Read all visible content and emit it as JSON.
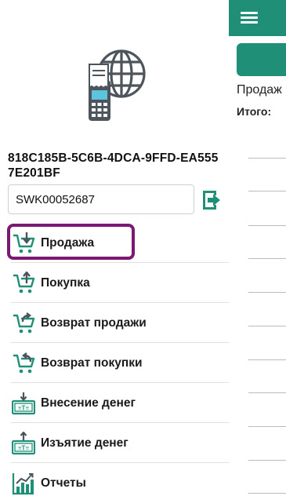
{
  "device": {
    "id": "818C185B-5C6B-4DCA-9FFD-EA5557E201BF",
    "serial_value": "SWK00052687"
  },
  "main": {
    "sale_title": "Продаж",
    "total_label": "Итого:"
  },
  "menu": {
    "items": [
      {
        "label": "Продажа",
        "icon": "cart-sale-icon",
        "selected": true
      },
      {
        "label": "Покупка",
        "icon": "cart-purchase-icon"
      },
      {
        "label": "Возврат продажи",
        "icon": "cart-return-sale-icon"
      },
      {
        "label": "Возврат покупки",
        "icon": "cart-return-purchase-icon"
      },
      {
        "label": "Внесение денег",
        "icon": "cash-in-icon"
      },
      {
        "label": "Изъятие денег",
        "icon": "cash-out-icon"
      },
      {
        "label": "Отчеты",
        "icon": "reports-chart-icon"
      }
    ]
  },
  "colors": {
    "accent": "#1f8f77",
    "highlight": "#7a1872"
  }
}
